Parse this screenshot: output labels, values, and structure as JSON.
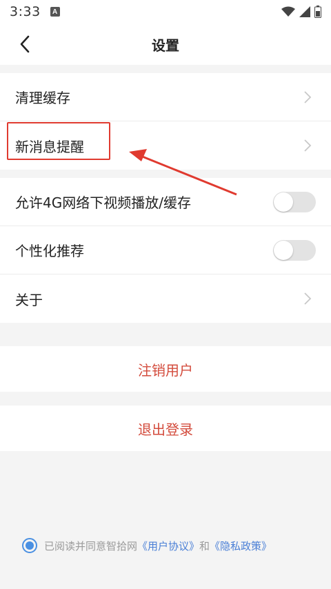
{
  "status_bar": {
    "time": "3:33",
    "notif_letter": "A"
  },
  "nav": {
    "title": "设置"
  },
  "group1": [
    {
      "label": "清理缓存"
    },
    {
      "label": "新消息提醒"
    }
  ],
  "group2": [
    {
      "label": "允许4G网络下视频播放/缓存",
      "toggle_on": false
    },
    {
      "label": "个性化推荐",
      "toggle_on": false
    },
    {
      "label": "关于"
    }
  ],
  "actions": {
    "deregister": "注销用户",
    "logout": "退出登录"
  },
  "agreement": {
    "prefix": "已阅读并同意智拾网",
    "user_agreement": "《用户协议》",
    "and": "和",
    "privacy_policy": "《隐私政策》",
    "checked": true
  },
  "colors": {
    "accent_red": "#d34b3c",
    "link_blue": "#4a7fd6",
    "annotation_red": "#e03a2f"
  }
}
